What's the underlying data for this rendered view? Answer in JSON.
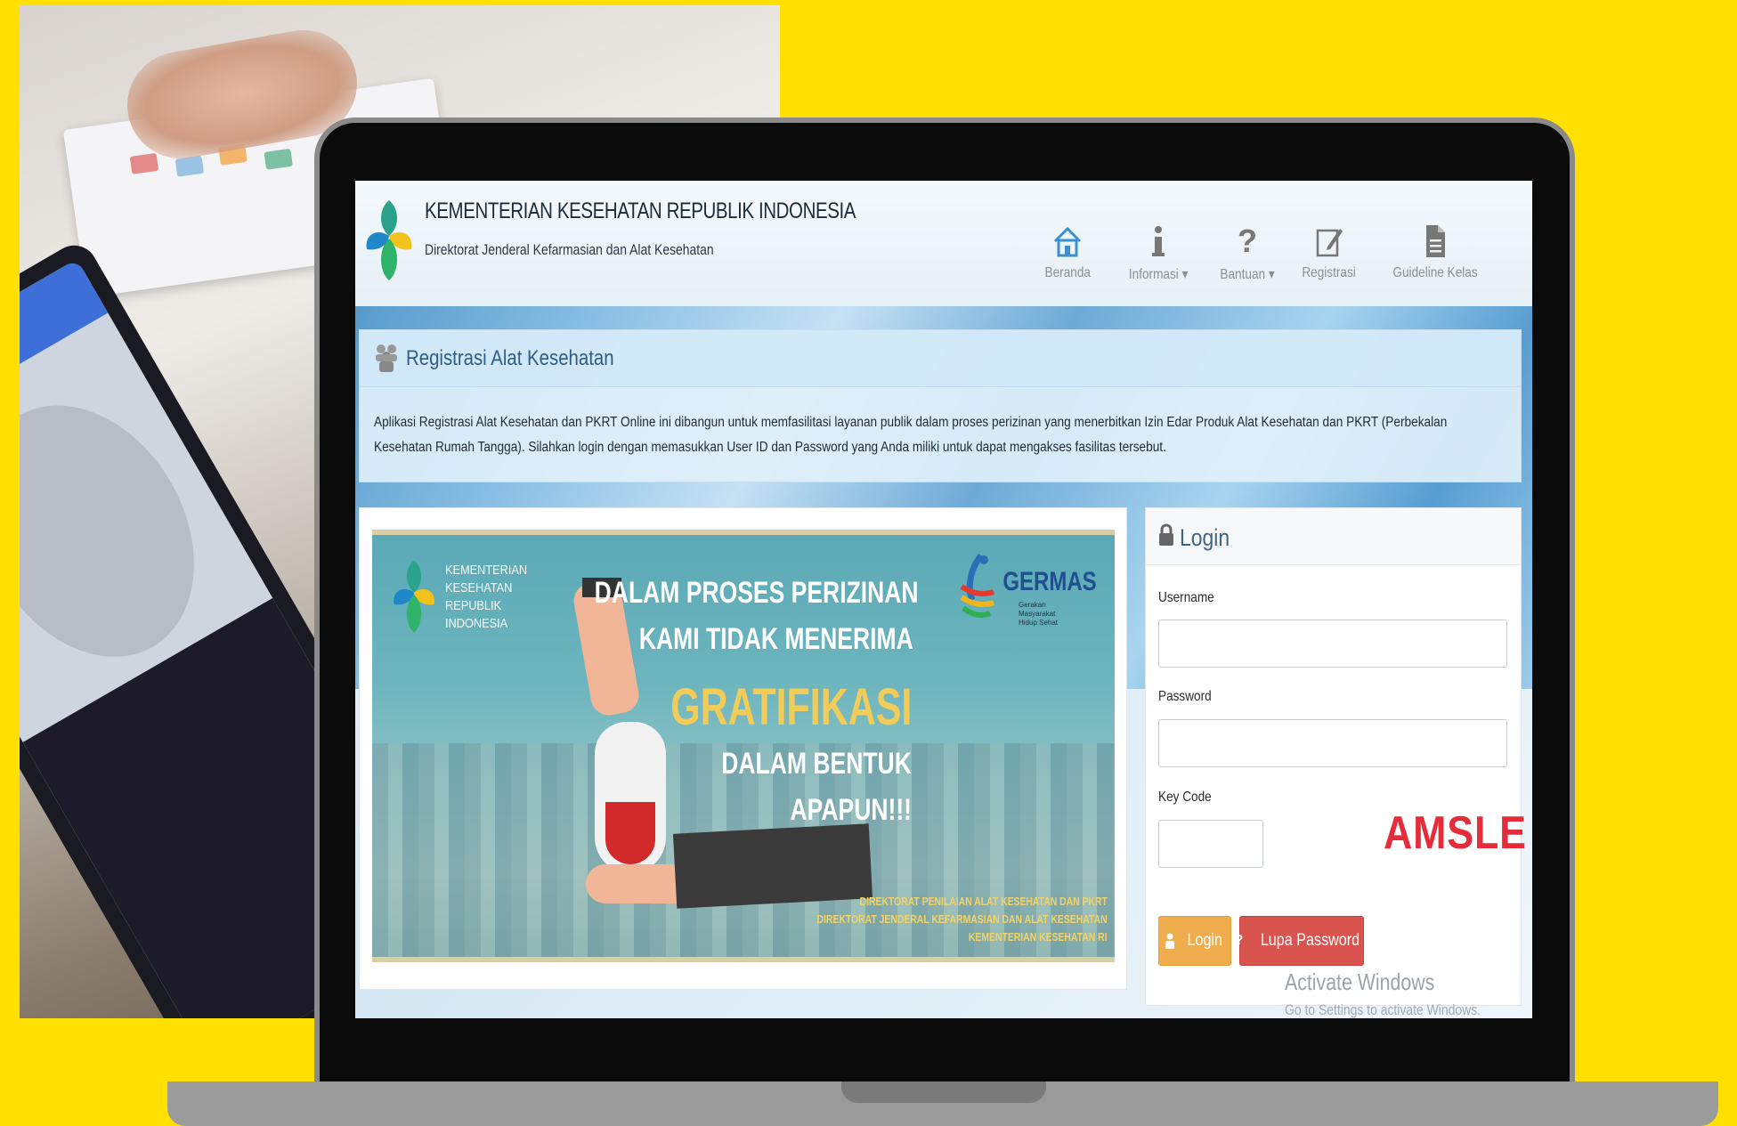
{
  "header": {
    "org_title": "KEMENTERIAN KESEHATAN REPUBLIK INDONESIA",
    "org_subtitle": "Direktorat Jenderal Kefarmasian dan Alat Kesehatan"
  },
  "nav": {
    "home": "Beranda",
    "info": "Informasi ▾",
    "help": "Bantuan ▾",
    "register": "Registrasi",
    "guideline": "Guideline Kelas"
  },
  "intro": {
    "title": "Registrasi Alat Kesehatan",
    "text": "Aplikasi Registrasi Alat Kesehatan dan PKRT Online ini dibangun untuk memfasilitasi layanan publik dalam proses perizinan yang menerbitkan Izin Edar Produk Alat Kesehatan dan PKRT (Perbekalan Kesehatan Rumah Tangga). Silahkan login dengan memasukkan User ID dan Password yang Anda miliki untuk dapat mengakses fasilitas tersebut."
  },
  "poster": {
    "kemenkes": [
      "KEMENTERIAN",
      "KESEHATAN",
      "REPUBLIK",
      "INDONESIA"
    ],
    "line1": "DALAM PROSES PERIZINAN",
    "line2": "KAMI TIDAK MENERIMA",
    "line3": "GRATIFIKASI",
    "line4": "DALAM BENTUK",
    "line5": "APAPUN!!!",
    "germas": "GERMAS",
    "germas_sub": "Gerakan Masyarakat Hidup Sehat",
    "footer1": "DIREKTORAT PENILAIAN ALAT KESEHATAN DAN PKRT",
    "footer2": "DIREKTORAT JENDERAL KEFARMASIAN DAN ALAT KESEHATAN",
    "footer3": "KEMENTERIAN KESEHATAN RI"
  },
  "login": {
    "title": "Login",
    "username_label": "Username",
    "username_value": "",
    "password_label": "Password",
    "password_value": "",
    "keycode_label": "Key Code",
    "keycode_value": "",
    "captcha": "AMSLE",
    "login_button": "Login",
    "forgot_button": "Lupa Password"
  },
  "watermark": {
    "line1": "Activate Windows",
    "line2": "Go to Settings to activate Windows."
  },
  "colors": {
    "background": "#FFE000",
    "login_button": "#f0ad4e",
    "forgot_button": "#d9534f",
    "captcha": "#e52c3a"
  }
}
